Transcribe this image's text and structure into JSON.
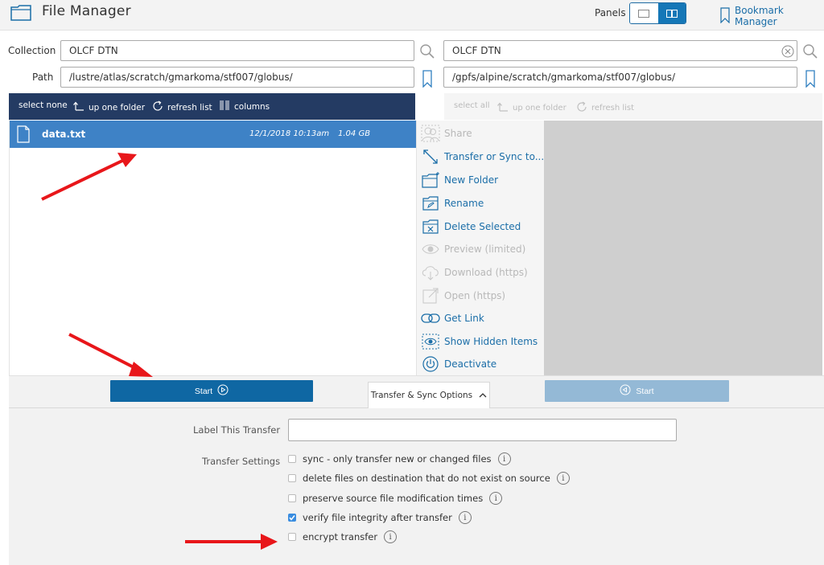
{
  "header": {
    "title": "File Manager",
    "panels_label": "Panels",
    "bookmark_manager": "Bookmark Manager"
  },
  "left": {
    "collection_label": "Collection",
    "path_label": "Path",
    "collection_value": "OLCF DTN",
    "path_value": "/lustre/atlas/scratch/gmarkoma/stf007/globus/",
    "toolbar": {
      "select_none": "select none",
      "up_one_folder": "up one folder",
      "refresh_list": "refresh list",
      "columns": "columns"
    },
    "files": [
      {
        "name": "data.txt",
        "date": "12/1/2018 10:13am",
        "size": "1.04 GB"
      }
    ]
  },
  "right": {
    "collection_value": "OLCF DTN",
    "path_value": "/gpfs/alpine/scratch/gmarkoma/stf007/globus/",
    "toolbar": {
      "select_all": "select all",
      "up_one_folder": "up one folder",
      "refresh_list": "refresh list"
    }
  },
  "context_menu": [
    {
      "label": "Share",
      "icon": "share-icon",
      "enabled": false
    },
    {
      "label": "Transfer or Sync to...",
      "icon": "transfer-icon",
      "enabled": true
    },
    {
      "label": "New Folder",
      "icon": "new-folder-icon",
      "enabled": true
    },
    {
      "label": "Rename",
      "icon": "rename-icon",
      "enabled": true
    },
    {
      "label": "Delete Selected",
      "icon": "delete-icon",
      "enabled": true
    },
    {
      "label": "Preview (limited)",
      "icon": "eye-icon",
      "enabled": false
    },
    {
      "label": "Download (https)",
      "icon": "download-icon",
      "enabled": false
    },
    {
      "label": "Open (https)",
      "icon": "open-icon",
      "enabled": false
    },
    {
      "label": "Get Link",
      "icon": "link-icon",
      "enabled": true
    },
    {
      "label": "Show Hidden Items",
      "icon": "hidden-items-icon",
      "enabled": true
    },
    {
      "label": "Deactivate",
      "icon": "power-icon",
      "enabled": true
    }
  ],
  "transfer": {
    "start_left": "Start",
    "start_right": "Start",
    "options_tab": "Transfer & Sync Options",
    "label_this_transfer": "Label This Transfer",
    "label_value": "",
    "transfer_settings": "Transfer Settings",
    "options": [
      {
        "label": "sync - only transfer new or changed files",
        "checked": false
      },
      {
        "label": "delete files on destination that do not exist on source",
        "checked": false
      },
      {
        "label": "preserve source file modification times",
        "checked": false
      },
      {
        "label": "verify file integrity after transfer",
        "checked": true
      },
      {
        "label": "encrypt transfer",
        "checked": false
      }
    ]
  },
  "colors": {
    "toolbar_dark": "#243b63",
    "selected_row": "#3e82c6",
    "primary_button": "#0f67a3",
    "disabled_button": "#94b9d6",
    "link": "#1b6ea8",
    "annotation_arrow": "#e8161a"
  }
}
